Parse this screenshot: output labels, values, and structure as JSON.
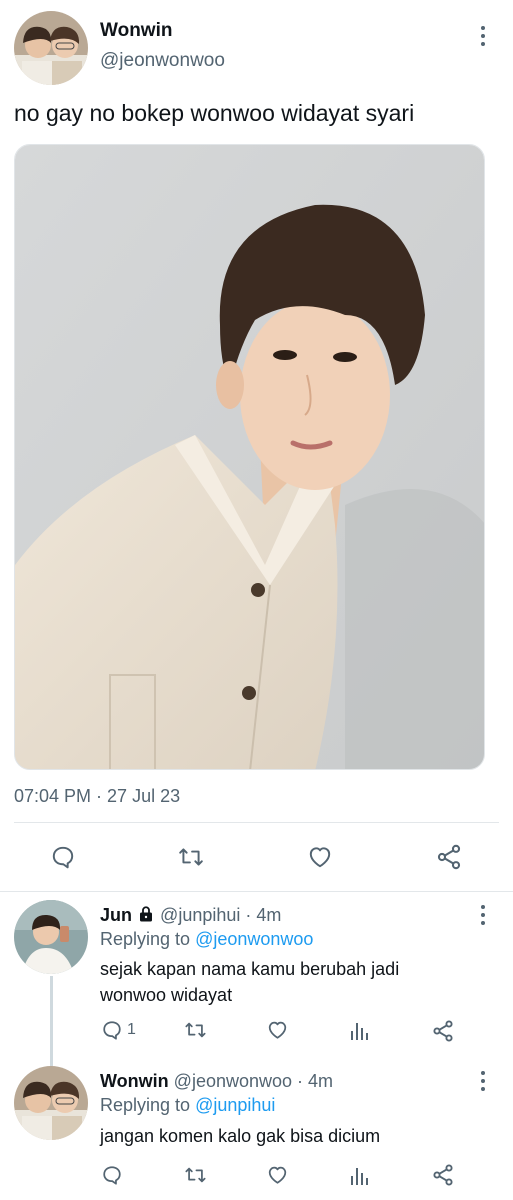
{
  "main_tweet": {
    "author_name": "Wonwin",
    "author_handle": "@jeonwonwoo",
    "text": "no gay no bokep wonwoo widayat syari",
    "timestamp": "07:04 PM · 27 Jul 23",
    "actions": [
      "reply-icon",
      "retweet-icon",
      "like-icon",
      "share-icon"
    ]
  },
  "replies": [
    {
      "author_name": "Jun",
      "locked": true,
      "author_handle": "@junpihui",
      "time": "· 4m",
      "replying_to_label": "Replying to",
      "replying_to": "@jeonwonwoo",
      "text_line1": "sejak kapan nama kamu berubah jadi",
      "text_line2": "wonwoo widayat",
      "reply_count": "1"
    },
    {
      "author_name": "Wonwin",
      "author_handle": "@jeonwonwoo",
      "time": "· 4m",
      "replying_to_label": "Replying to",
      "replying_to": "@junpihui",
      "text_line1": "jangan komen kalo gak bisa dicium"
    }
  ],
  "colors": {
    "text": "#0f1419",
    "muted": "#536471",
    "link": "#1d9bf0",
    "divider": "#e3e7ea"
  }
}
